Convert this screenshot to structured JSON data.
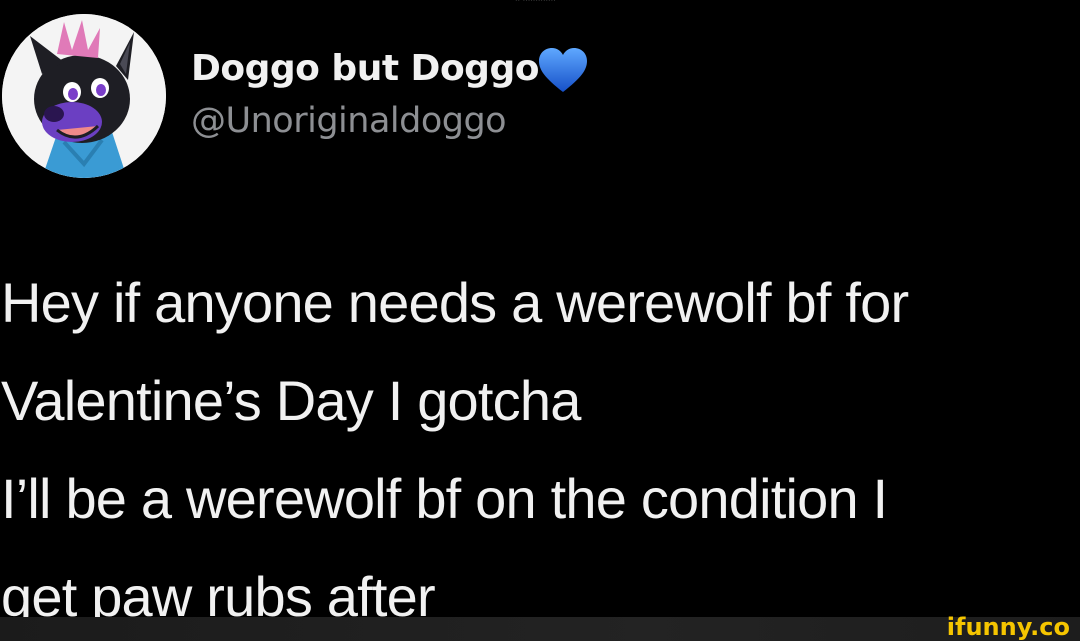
{
  "tweet": {
    "display_name": "Doggo but Doggo",
    "handle": "@Unoriginaldoggo",
    "verified_icon": "blue-heart-icon",
    "body_lines": [
      "Hey if anyone needs a werewolf bf for",
      "Valentine’s Day I gotcha",
      "I’ll be a werewolf bf on the condition I",
      "get paw rubs after"
    ]
  },
  "watermark": {
    "text": "ifunny.co",
    "color": "#f5c500"
  },
  "colors": {
    "background": "#000000",
    "text_primary": "#f1f1f1",
    "text_secondary": "#8d8f93",
    "heart": "#1f6fe0"
  }
}
